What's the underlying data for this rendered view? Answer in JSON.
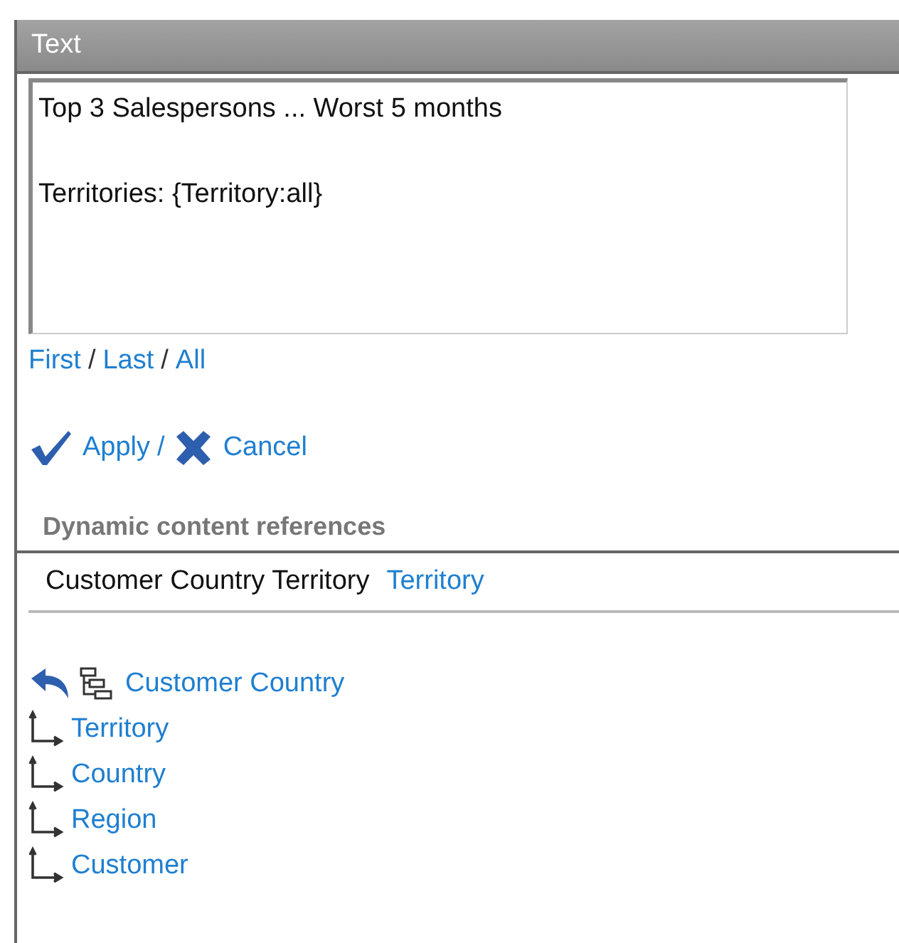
{
  "panel": {
    "title": "Text"
  },
  "editor": {
    "paragraphs": [
      "Top 3 Salespersons ... Worst 5 months",
      "Territories: {Territory:all}"
    ]
  },
  "range_links": {
    "items": [
      "First",
      "Last",
      "All"
    ],
    "separators": [
      "/",
      "/"
    ]
  },
  "action_separator": "/",
  "actions": [
    {
      "kind": "apply",
      "label": "Apply"
    },
    {
      "kind": "cancel",
      "label": "Cancel"
    }
  ],
  "references": {
    "title": "Dynamic content references",
    "current": {
      "label": "Customer Country Territory",
      "link": "Territory"
    },
    "hierarchy": {
      "label": "Customer Country",
      "children": [
        {
          "label": "Territory"
        },
        {
          "label": "Country"
        },
        {
          "label": "Region"
        },
        {
          "label": "Customer"
        }
      ]
    }
  }
}
